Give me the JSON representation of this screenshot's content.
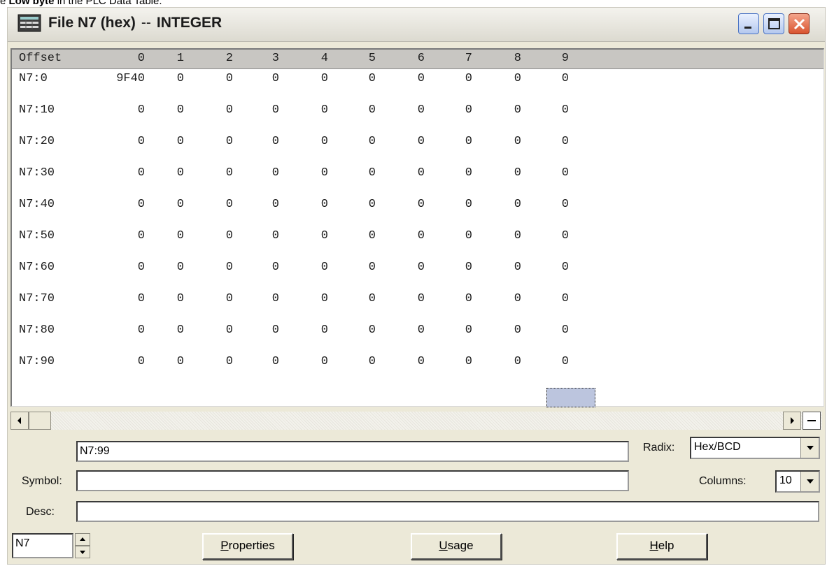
{
  "caption": {
    "prefix": "e ",
    "bold": "Low byte",
    "suffix": " in the PLC Data Table."
  },
  "window": {
    "title_main": "File N7 (hex)",
    "title_sep": "--",
    "title_type": "INTEGER",
    "icon": "data-table-icon",
    "controls": [
      "minimize-icon",
      "maximize-icon",
      "close-icon"
    ]
  },
  "table": {
    "offset_label": "Offset",
    "columns": [
      "0",
      "1",
      "2",
      "3",
      "4",
      "5",
      "6",
      "7",
      "8",
      "9"
    ],
    "rows": [
      {
        "offset": "N7:0",
        "values": [
          "9F40",
          "0",
          "0",
          "0",
          "0",
          "0",
          "0",
          "0",
          "0",
          "0"
        ]
      },
      {
        "offset": "N7:10",
        "values": [
          "0",
          "0",
          "0",
          "0",
          "0",
          "0",
          "0",
          "0",
          "0",
          "0"
        ]
      },
      {
        "offset": "N7:20",
        "values": [
          "0",
          "0",
          "0",
          "0",
          "0",
          "0",
          "0",
          "0",
          "0",
          "0"
        ]
      },
      {
        "offset": "N7:30",
        "values": [
          "0",
          "0",
          "0",
          "0",
          "0",
          "0",
          "0",
          "0",
          "0",
          "0"
        ]
      },
      {
        "offset": "N7:40",
        "values": [
          "0",
          "0",
          "0",
          "0",
          "0",
          "0",
          "0",
          "0",
          "0",
          "0"
        ]
      },
      {
        "offset": "N7:50",
        "values": [
          "0",
          "0",
          "0",
          "0",
          "0",
          "0",
          "0",
          "0",
          "0",
          "0"
        ]
      },
      {
        "offset": "N7:60",
        "values": [
          "0",
          "0",
          "0",
          "0",
          "0",
          "0",
          "0",
          "0",
          "0",
          "0"
        ]
      },
      {
        "offset": "N7:70",
        "values": [
          "0",
          "0",
          "0",
          "0",
          "0",
          "0",
          "0",
          "0",
          "0",
          "0"
        ]
      },
      {
        "offset": "N7:80",
        "values": [
          "0",
          "0",
          "0",
          "0",
          "0",
          "0",
          "0",
          "0",
          "0",
          "0"
        ]
      },
      {
        "offset": "N7:90",
        "values": [
          "0",
          "0",
          "0",
          "0",
          "0",
          "0",
          "0",
          "0",
          "0",
          "0"
        ]
      }
    ],
    "selected_cell": "N7:99"
  },
  "address_field": {
    "value": "N7:99"
  },
  "radix": {
    "label": "Radix:",
    "value": "Hex/BCD"
  },
  "symbol": {
    "label": "Symbol:",
    "value": ""
  },
  "columns_setting": {
    "label": "Columns:",
    "value": "10"
  },
  "desc": {
    "label": "Desc:",
    "value": ""
  },
  "file_field": {
    "value": "N7"
  },
  "buttons": {
    "properties": {
      "mnemonic": "P",
      "rest": "roperties"
    },
    "usage": {
      "mnemonic": "U",
      "rest": "sage"
    },
    "help": {
      "mnemonic": "H",
      "rest": "elp"
    }
  }
}
